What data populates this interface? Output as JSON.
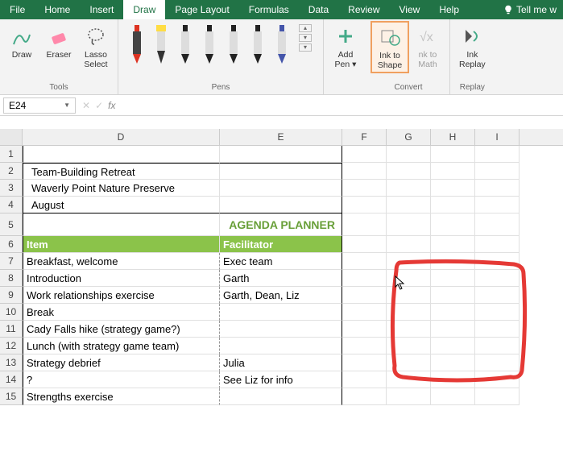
{
  "tabs": [
    "File",
    "Home",
    "Insert",
    "Draw",
    "Page Layout",
    "Formulas",
    "Data",
    "Review",
    "View",
    "Help"
  ],
  "active_tab": "Draw",
  "tell_me": "Tell me w",
  "ribbon": {
    "tools_label": "Tools",
    "draw": "Draw",
    "eraser": "Eraser",
    "lasso1": "Lasso",
    "lasso2": "Select",
    "pens_label": "Pens",
    "add_pen1": "Add",
    "add_pen2": "Pen",
    "convert_label": "Convert",
    "ink_shape1": "Ink to",
    "ink_shape2": "Shape",
    "ink_math1": "nk to",
    "ink_math2": "Math",
    "replay_label": "Replay",
    "ink_replay1": "Ink",
    "ink_replay2": "Replay"
  },
  "name_box": "E24",
  "fx_label": "fx",
  "columns": [
    "D",
    "E",
    "F",
    "G",
    "H",
    "I"
  ],
  "rows": {
    "2": {
      "D": "Team-Building Retreat"
    },
    "3": {
      "D": "Waverly Point Nature Preserve"
    },
    "4": {
      "D": "August"
    },
    "5": {
      "E": "AGENDA PLANNER"
    },
    "6": {
      "D": "Item",
      "E": "Facilitator"
    },
    "7": {
      "D": "Breakfast, welcome",
      "E": "Exec team"
    },
    "8": {
      "D": "Introduction",
      "E": "Garth"
    },
    "9": {
      "D": "Work relationships exercise",
      "E": "Garth, Dean, Liz"
    },
    "10": {
      "D": "Break"
    },
    "11": {
      "D": "Cady Falls hike (strategy game?)"
    },
    "12": {
      "D": "Lunch (with strategy game team)"
    },
    "13": {
      "D": "Strategy debrief",
      "E": "Julia"
    },
    "14": {
      "D": "?",
      "E": "See Liz for info"
    },
    "15": {
      "D": "Strengths exercise"
    }
  }
}
